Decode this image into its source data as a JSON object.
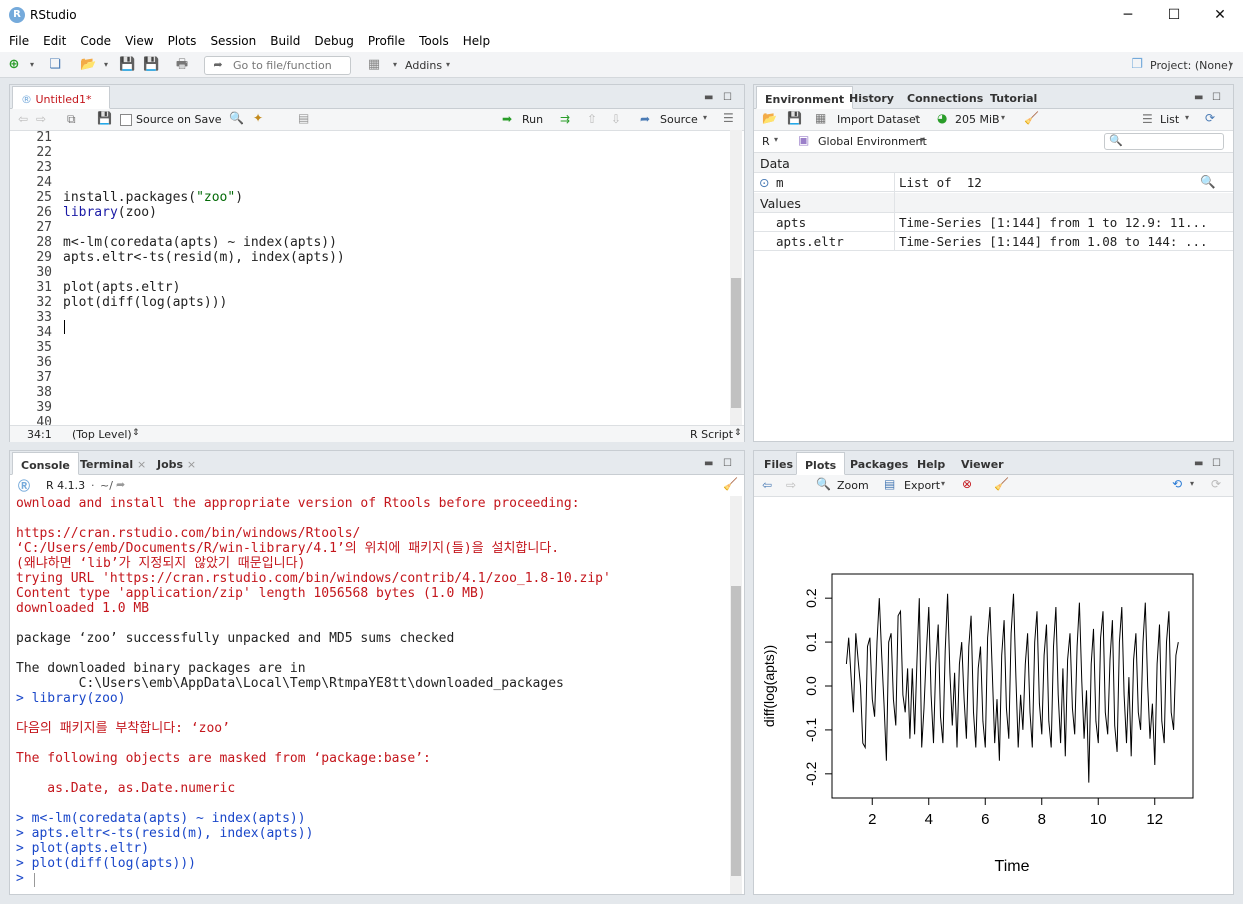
{
  "window": {
    "title": "RStudio",
    "minimize": "─",
    "maximize": "☐",
    "close": "✕"
  },
  "menu": [
    "File",
    "Edit",
    "Code",
    "View",
    "Plots",
    "Session",
    "Build",
    "Debug",
    "Profile",
    "Tools",
    "Help"
  ],
  "toolbar": {
    "goto_placeholder": "Go to file/function",
    "addins": "Addins",
    "project": "Project: (None)"
  },
  "editor": {
    "tab": "Untitled1*",
    "source_on_save": "Source on Save",
    "run": "Run",
    "source": "Source",
    "line_numbers": [
      "21",
      "22",
      "23",
      "24",
      "25",
      "26",
      "27",
      "28",
      "29",
      "30",
      "31",
      "32",
      "33",
      "34",
      "35",
      "36",
      "37",
      "38",
      "39",
      "40"
    ],
    "lines": [
      "",
      "",
      "",
      "",
      "install.packages(\"zoo\")",
      "library(zoo)",
      "",
      "m<-lm(coredata(apts) ~ index(apts))",
      "apts.eltr<-ts(resid(m), index(apts))",
      "",
      "plot(apts.eltr)",
      "plot(diff(log(apts)))",
      "",
      "",
      "",
      "",
      "",
      "",
      "",
      ""
    ],
    "status_pos": "34:1",
    "status_scope": "(Top Level)",
    "status_type": "R Script"
  },
  "console": {
    "tabs": [
      "Console",
      "Terminal",
      "Jobs"
    ],
    "version": "R 4.1.3",
    "path": "~/",
    "lines": [
      {
        "t": "ownload and install the appropriate version of Rtools before proceeding:",
        "c": "red"
      },
      {
        "t": "",
        "c": "red"
      },
      {
        "t": "https://cran.rstudio.com/bin/windows/Rtools/",
        "c": "red"
      },
      {
        "t": "‘C:/Users/emb/Documents/R/win-library/4.1’의 위치에 패키지(들)을 설치합니다.",
        "c": "red"
      },
      {
        "t": "(왜냐하면 ‘lib’가 지정되지 않았기 때문입니다)",
        "c": "red"
      },
      {
        "t": "trying URL 'https://cran.rstudio.com/bin/windows/contrib/4.1/zoo_1.8-10.zip'",
        "c": "red"
      },
      {
        "t": "Content type 'application/zip' length 1056568 bytes (1.0 MB)",
        "c": "red"
      },
      {
        "t": "downloaded 1.0 MB",
        "c": "red"
      },
      {
        "t": "",
        "c": ""
      },
      {
        "t": "package ‘zoo’ successfully unpacked and MD5 sums checked",
        "c": ""
      },
      {
        "t": "",
        "c": ""
      },
      {
        "t": "The downloaded binary packages are in",
        "c": ""
      },
      {
        "t": "        C:\\Users\\emb\\AppData\\Local\\Temp\\RtmpaYE8tt\\downloaded_packages",
        "c": ""
      },
      {
        "t": "> library(zoo)",
        "c": "blue"
      },
      {
        "t": "",
        "c": ""
      },
      {
        "t": "다음의 패키지를 부착합니다: ‘zoo’",
        "c": "red"
      },
      {
        "t": "",
        "c": ""
      },
      {
        "t": "The following objects are masked from ‘package:base’:",
        "c": "red"
      },
      {
        "t": "",
        "c": ""
      },
      {
        "t": "    as.Date, as.Date.numeric",
        "c": "red"
      },
      {
        "t": "",
        "c": ""
      },
      {
        "t": "> m<-lm(coredata(apts) ~ index(apts))",
        "c": "blue"
      },
      {
        "t": "> apts.eltr<-ts(resid(m), index(apts))",
        "c": "blue"
      },
      {
        "t": "> plot(apts.eltr)",
        "c": "blue"
      },
      {
        "t": "> plot(diff(log(apts)))",
        "c": "blue"
      },
      {
        "t": "> ",
        "c": "blue"
      }
    ]
  },
  "environment": {
    "tabs": [
      "Environment",
      "History",
      "Connections",
      "Tutorial"
    ],
    "import": "Import Dataset",
    "memory": "205 MiB",
    "view": "List",
    "lang": "R",
    "scope": "Global Environment",
    "sections": {
      "data": "Data",
      "values": "Values"
    },
    "data_rows": [
      {
        "name": "m",
        "value": "List of  12"
      }
    ],
    "value_rows": [
      {
        "name": "apts",
        "value": "Time-Series [1:144] from 1 to 12.9: 11..."
      },
      {
        "name": "apts.eltr",
        "value": "Time-Series [1:144] from 1.08 to 144: ..."
      }
    ]
  },
  "files": {
    "tabs": [
      "Files",
      "Plots",
      "Packages",
      "Help",
      "Viewer"
    ],
    "zoom": "Zoom",
    "export": "Export"
  },
  "chart_data": {
    "type": "line",
    "xlabel": "Time",
    "ylabel": "diff(log(apts))",
    "xlim": [
      1.0,
      13.0
    ],
    "ylim": [
      -0.23,
      0.23
    ],
    "xticks": [
      "2",
      "4",
      "6",
      "8",
      "10",
      "12"
    ],
    "yticks": [
      "-0.2",
      "-0.1",
      "0.0",
      "0.1",
      "0.2"
    ],
    "series": [
      {
        "values": [
          0.05,
          0.11,
          0.02,
          -0.06,
          0.12,
          0.06,
          0.0,
          -0.13,
          -0.14,
          0.09,
          0.11,
          -0.03,
          -0.07,
          0.1,
          0.2,
          0.07,
          -0.04,
          -0.17,
          0.1,
          0.12,
          -0.03,
          -0.09,
          0.16,
          0.17,
          -0.02,
          -0.06,
          0.04,
          -0.12,
          0.04,
          -0.11,
          0.06,
          0.2,
          -0.14,
          -0.05,
          0.08,
          0.18,
          -0.02,
          -0.13,
          0.05,
          0.14,
          -0.07,
          -0.13,
          0.08,
          0.21,
          0.03,
          -0.09,
          0.03,
          -0.14,
          0.05,
          0.1,
          -0.03,
          -0.12,
          0.09,
          0.16,
          -0.06,
          -0.14,
          0.04,
          0.09,
          -0.08,
          -0.14,
          0.11,
          0.18,
          0.03,
          -0.13,
          -0.03,
          -0.17,
          0.07,
          0.15,
          -0.05,
          -0.12,
          0.12,
          0.21,
          0.02,
          -0.14,
          -0.02,
          -0.1,
          0.05,
          0.12,
          -0.06,
          -0.14,
          0.1,
          0.17,
          -0.04,
          -0.11,
          0.07,
          0.14,
          -0.08,
          -0.14,
          0.09,
          0.18,
          -0.02,
          -0.13,
          0.04,
          -0.16,
          0.06,
          0.12,
          -0.05,
          -0.11,
          0.09,
          0.19,
          0.01,
          -0.12,
          -0.01,
          -0.22,
          0.05,
          0.13,
          -0.08,
          -0.13,
          0.11,
          0.17,
          -0.06,
          -0.11,
          0.06,
          0.15,
          -0.09,
          -0.15,
          0.1,
          0.18,
          -0.02,
          -0.13,
          0.02,
          -0.16,
          0.06,
          0.12,
          -0.06,
          -0.1,
          0.1,
          0.19,
          0.0,
          -0.12,
          -0.04,
          -0.18,
          0.05,
          0.14,
          -0.08,
          -0.13,
          0.1,
          0.17,
          -0.06,
          -0.1,
          0.07,
          0.1
        ],
        "color": "#000000"
      }
    ]
  }
}
